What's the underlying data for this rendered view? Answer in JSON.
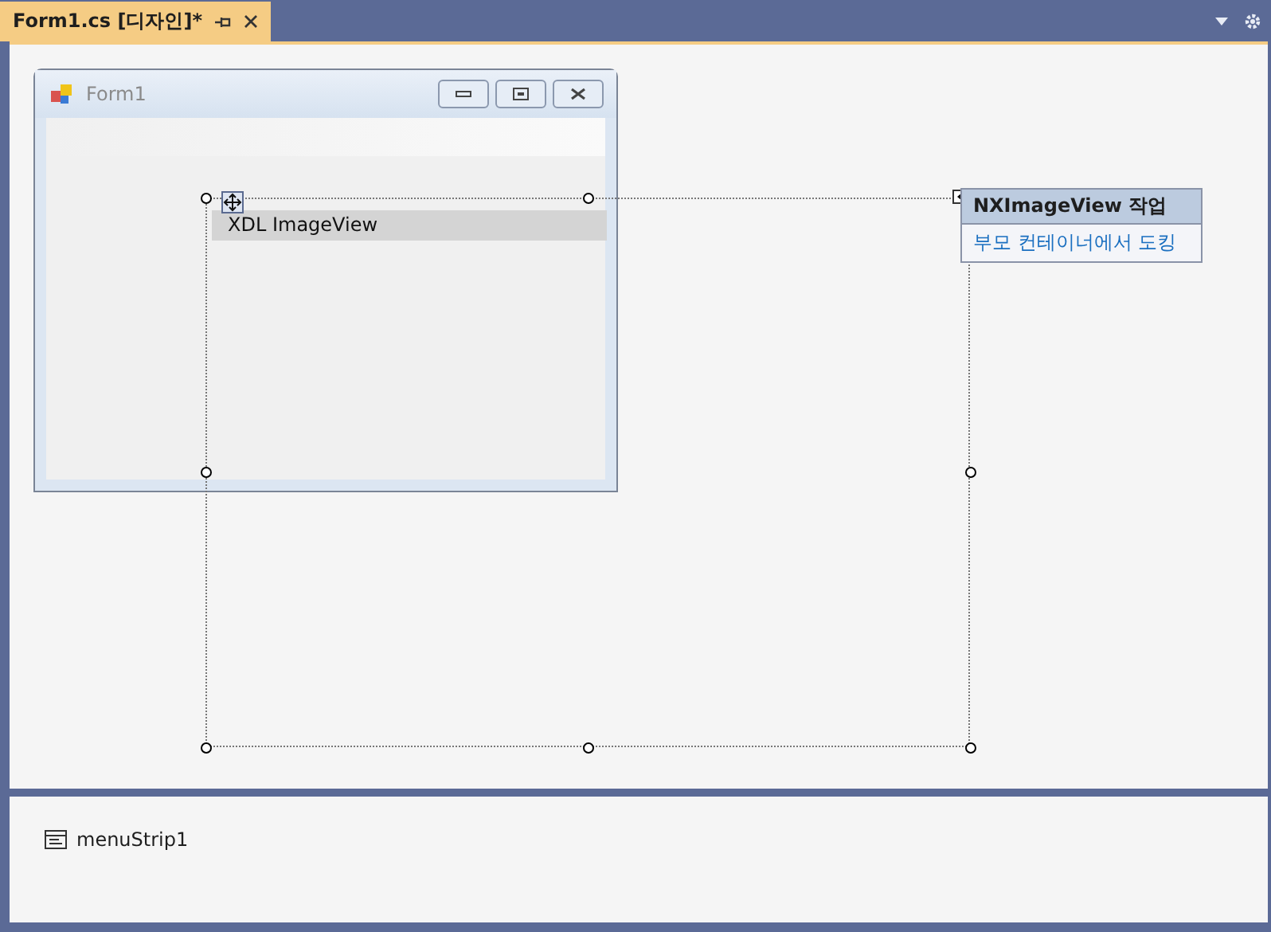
{
  "tabs": [
    {
      "title": "Form1.cs [디자인]*",
      "selected": true
    }
  ],
  "form": {
    "title": "Form1"
  },
  "control": {
    "label": "XDL ImageView"
  },
  "smart_tag": {
    "title": "NXImageView 작업",
    "actions": [
      "부모 컨테이너에서 도킹"
    ]
  },
  "component_tray": [
    {
      "name": "menuStrip1"
    }
  ]
}
